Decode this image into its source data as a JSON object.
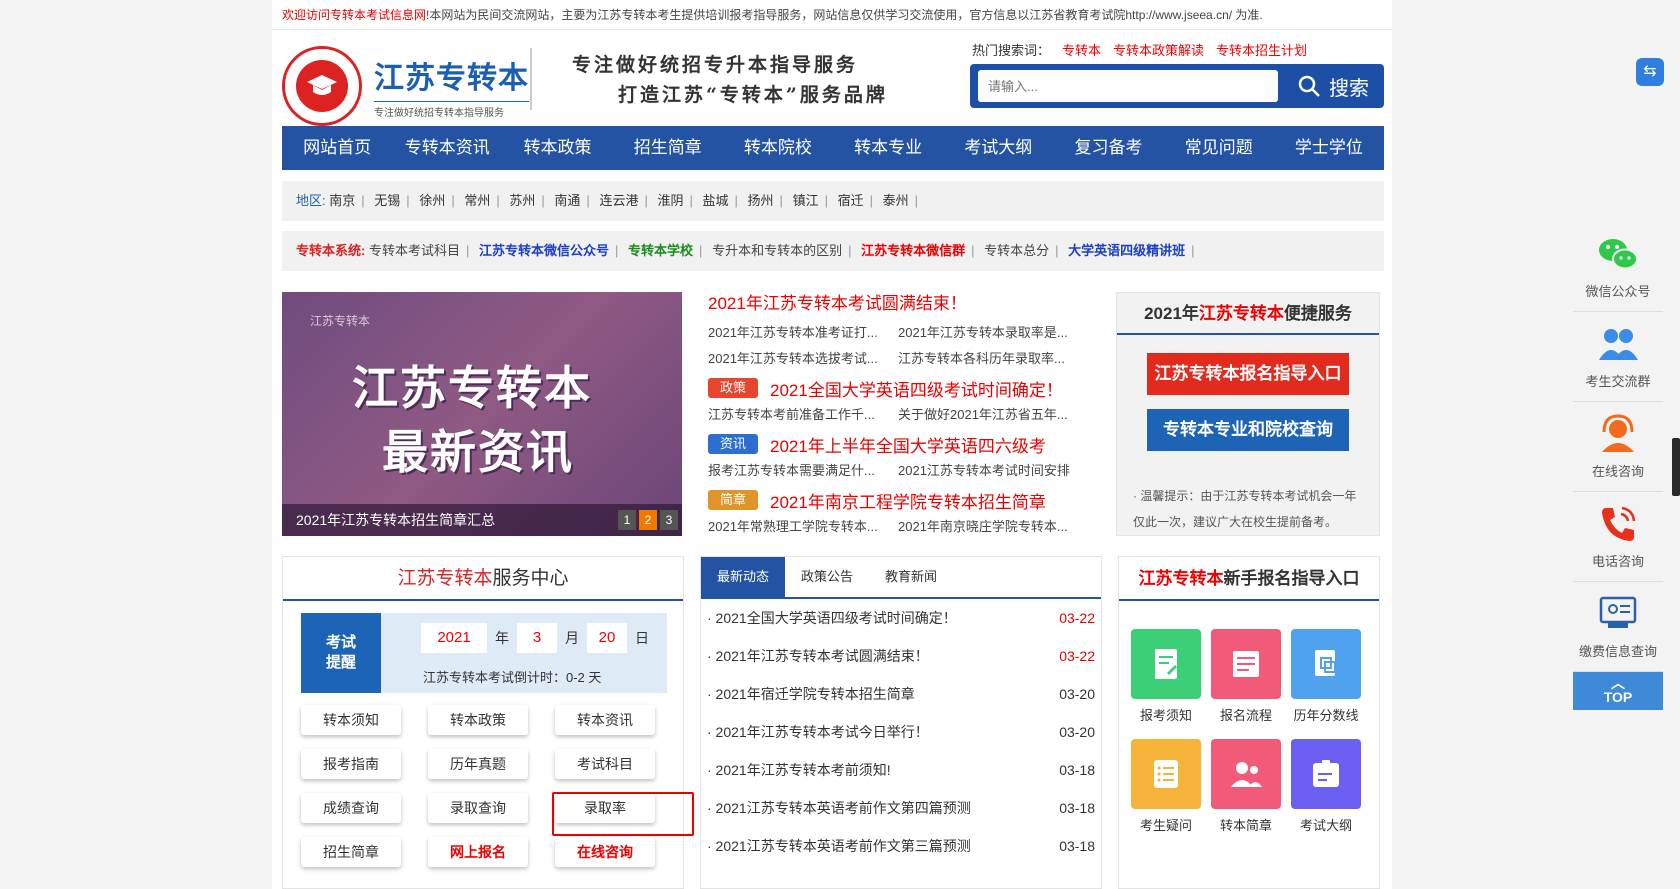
{
  "topbar": {
    "red_text": "欢迎访问专转本考试信息网",
    "text": "!本网站为民间交流网站，主要为江苏专转本考生提供培训报考指导服务，网站信息仅供学习交流使用，官方信息以江苏省教育考试院http://www.jseea.cn/ 为准."
  },
  "header": {
    "logo_title": "江苏专转本",
    "logo_sub": "专注做好统招专转本指导服务",
    "slogan_line1": "专注做好统招专升本指导服务",
    "slogan_line2": "打造江苏“专转本”服务品牌",
    "hot_label": "热门搜索词：",
    "hot_words": [
      "专转本",
      "专转本政策解读",
      "专转本招生计划"
    ],
    "search_placeholder": "请输入...",
    "search_button": "搜索"
  },
  "nav": [
    "网站首页",
    "专转本资讯",
    "转本政策",
    "招生简章",
    "转本院校",
    "转本专业",
    "考试大纲",
    "复习备考",
    "常见问题",
    "学士学位"
  ],
  "region": {
    "label": "地区:",
    "items": [
      "南京",
      "无锡",
      "徐州",
      "常州",
      "苏州",
      "南通",
      "连云港",
      "淮阴",
      "盐城",
      "扬州",
      "镇江",
      "宿迁",
      "泰州"
    ]
  },
  "system": {
    "label": "专转本系统:",
    "items": [
      {
        "text": "专转本考试科目",
        "style": "plain"
      },
      {
        "text": "江苏专转本微信公众号",
        "style": "blue"
      },
      {
        "text": "专转本学校",
        "style": "green"
      },
      {
        "text": "专升本和专转本的区别",
        "style": "plain"
      },
      {
        "text": "江苏专转本微信群",
        "style": "red"
      },
      {
        "text": "专转本总分",
        "style": "plain"
      },
      {
        "text": "大学英语四级精讲班",
        "style": "blue"
      }
    ]
  },
  "banner": {
    "brand": "江苏专转本",
    "title1": "江苏专转本",
    "title2": "最新资讯",
    "caption": "2021年江苏专转本招生简章汇总",
    "pages": [
      "1",
      "2",
      "3"
    ],
    "active_page": "2"
  },
  "news": {
    "headline": "2021年江苏专转本考试圆满结束！",
    "rows1": [
      [
        "2021年江苏专转本准考证打...",
        "2021年江苏专转本录取率是..."
      ],
      [
        "2021年江苏专转本选拔考试...",
        "江苏专转本各科历年录取率..."
      ]
    ],
    "tag1": {
      "tag": "政策",
      "color": "#e8452f",
      "title": "2021全国大学英语四级考试时间确定！"
    },
    "rows2": [
      [
        "江苏专转本考前准备工作千...",
        "关于做好2021年江苏省五年..."
      ]
    ],
    "tag2": {
      "tag": "资讯",
      "color": "#2d6fd0",
      "title": "2021年上半年全国大学英语四六级考"
    },
    "rows3": [
      [
        "报考江苏专转本需要满足什...",
        "2021江苏专转本考试时间安排"
      ]
    ],
    "tag3": {
      "tag": "简章",
      "color": "#e0952a",
      "title": "2021年南京工程学院专转本招生简章"
    },
    "rows4": [
      [
        "2021年常熟理工学院专转本...",
        "2021年南京晓庄学院专转本..."
      ]
    ]
  },
  "service": {
    "title_pre": "2021年",
    "title_red": "江苏专转本",
    "title_post": "便捷服务",
    "btn1": "江苏专转本报名指导入口",
    "btn2": "专转本专业和院校查询",
    "tip": "· 温馨提示：由于江苏专转本考试机会一年仅此一次，建议广大在校生提前备考。"
  },
  "center": {
    "title_red": "江苏专转本",
    "title_post": "服务中心",
    "remind_label1": "考试",
    "remind_label2": "提醒",
    "year": "2021",
    "year_unit": "年",
    "month": "3",
    "month_unit": "月",
    "day": "20",
    "day_unit": "日",
    "countdown": "江苏专转本考试倒计时：0-2 天",
    "buttons": [
      {
        "label": "转本须知",
        "red": false
      },
      {
        "label": "转本政策",
        "red": false
      },
      {
        "label": "转本资讯",
        "red": false
      },
      {
        "label": "报考指南",
        "red": false
      },
      {
        "label": "历年真题",
        "red": false
      },
      {
        "label": "考试科目",
        "red": false
      },
      {
        "label": "成绩查询",
        "red": false
      },
      {
        "label": "录取查询",
        "red": false
      },
      {
        "label": "录取率",
        "red": false
      },
      {
        "label": "招生简章",
        "red": false
      },
      {
        "label": "网上报名",
        "red": true
      },
      {
        "label": "在线咨询",
        "red": true
      }
    ]
  },
  "tabs": {
    "items": [
      "最新动态",
      "政策公告",
      "教育新闻"
    ],
    "active": "最新动态",
    "list": [
      {
        "title": "· 2021全国大学英语四级考试时间确定！",
        "date": "03-22",
        "new": true
      },
      {
        "title": "· 2021年江苏专转本考试圆满结束！",
        "date": "03-22",
        "new": true
      },
      {
        "title": "· 2021年宿迁学院专转本招生简章",
        "date": "03-20",
        "new": false
      },
      {
        "title": "· 2021年江苏专转本考试今日举行！",
        "date": "03-20",
        "new": false
      },
      {
        "title": "· 2021年江苏专转本考前须知!",
        "date": "03-18",
        "new": false
      },
      {
        "title": "· 2021江苏专转本英语考前作文第四篇预测",
        "date": "03-18",
        "new": false
      },
      {
        "title": "· 2021江苏专转本英语考前作文第三篇预测",
        "date": "03-18",
        "new": false
      }
    ]
  },
  "guide": {
    "title_red": "江苏专转本",
    "title_post": "新手报名指导入口",
    "items": [
      {
        "label": "报考须知",
        "color": "#3ccf77",
        "icon": "note-edit-icon"
      },
      {
        "label": "报名流程",
        "color": "#f25a7a",
        "icon": "form-icon"
      },
      {
        "label": "历年分数线",
        "color": "#4fa3ee",
        "icon": "document-copy-icon"
      },
      {
        "label": "考生疑问",
        "color": "#f5b33a",
        "icon": "list-icon"
      },
      {
        "label": "转本简章",
        "color": "#f25a7a",
        "icon": "users-icon"
      },
      {
        "label": "考试大纲",
        "color": "#6a5ff0",
        "icon": "card-icon"
      }
    ]
  },
  "float": {
    "items": [
      {
        "label": "微信公众号",
        "icon": "wechat-icon"
      },
      {
        "label": "考生交流群",
        "icon": "group-icon"
      },
      {
        "label": "在线咨询",
        "icon": "headset-icon"
      },
      {
        "label": "电话咨询",
        "icon": "phone-icon"
      },
      {
        "label": "缴费信息查询",
        "icon": "payment-query-icon"
      }
    ],
    "top_label": "TOP"
  }
}
